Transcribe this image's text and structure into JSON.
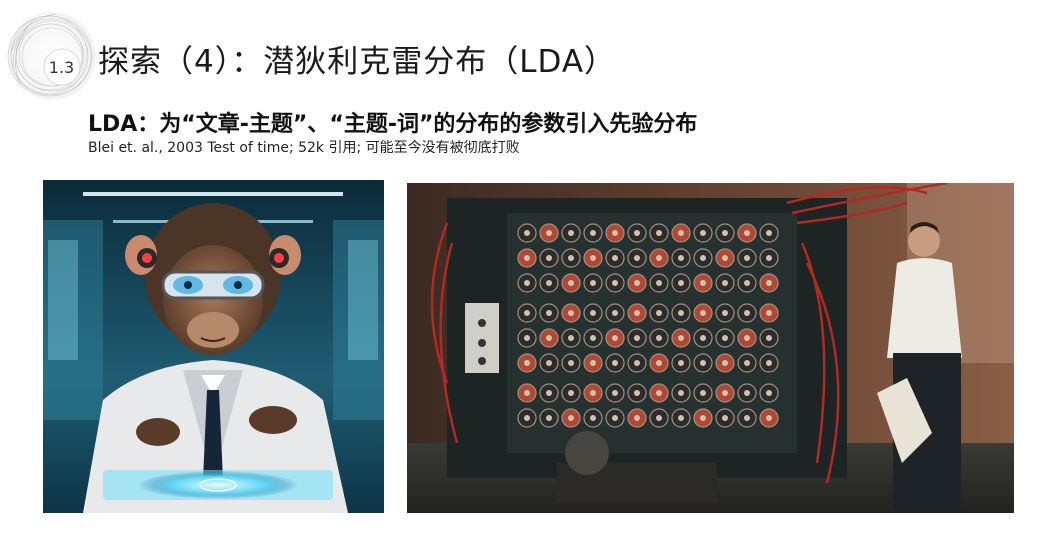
{
  "slide": {
    "section_number": "1.3",
    "title": "探索（4）：潜狄利克雷分布（LDA）",
    "subtitle": "LDA：为“文章-主题”、“主题-词”的分布的参数引入先验分布",
    "citation": "Blei et. al., 2003 Test of time; 52k 引用; 可能至今没有被彻底打败"
  },
  "images": {
    "left": "scientist-monkey-with-goggles-at-glowing-touchscreen",
    "right": "man-beside-large-electromechanical-rotor-machine"
  }
}
